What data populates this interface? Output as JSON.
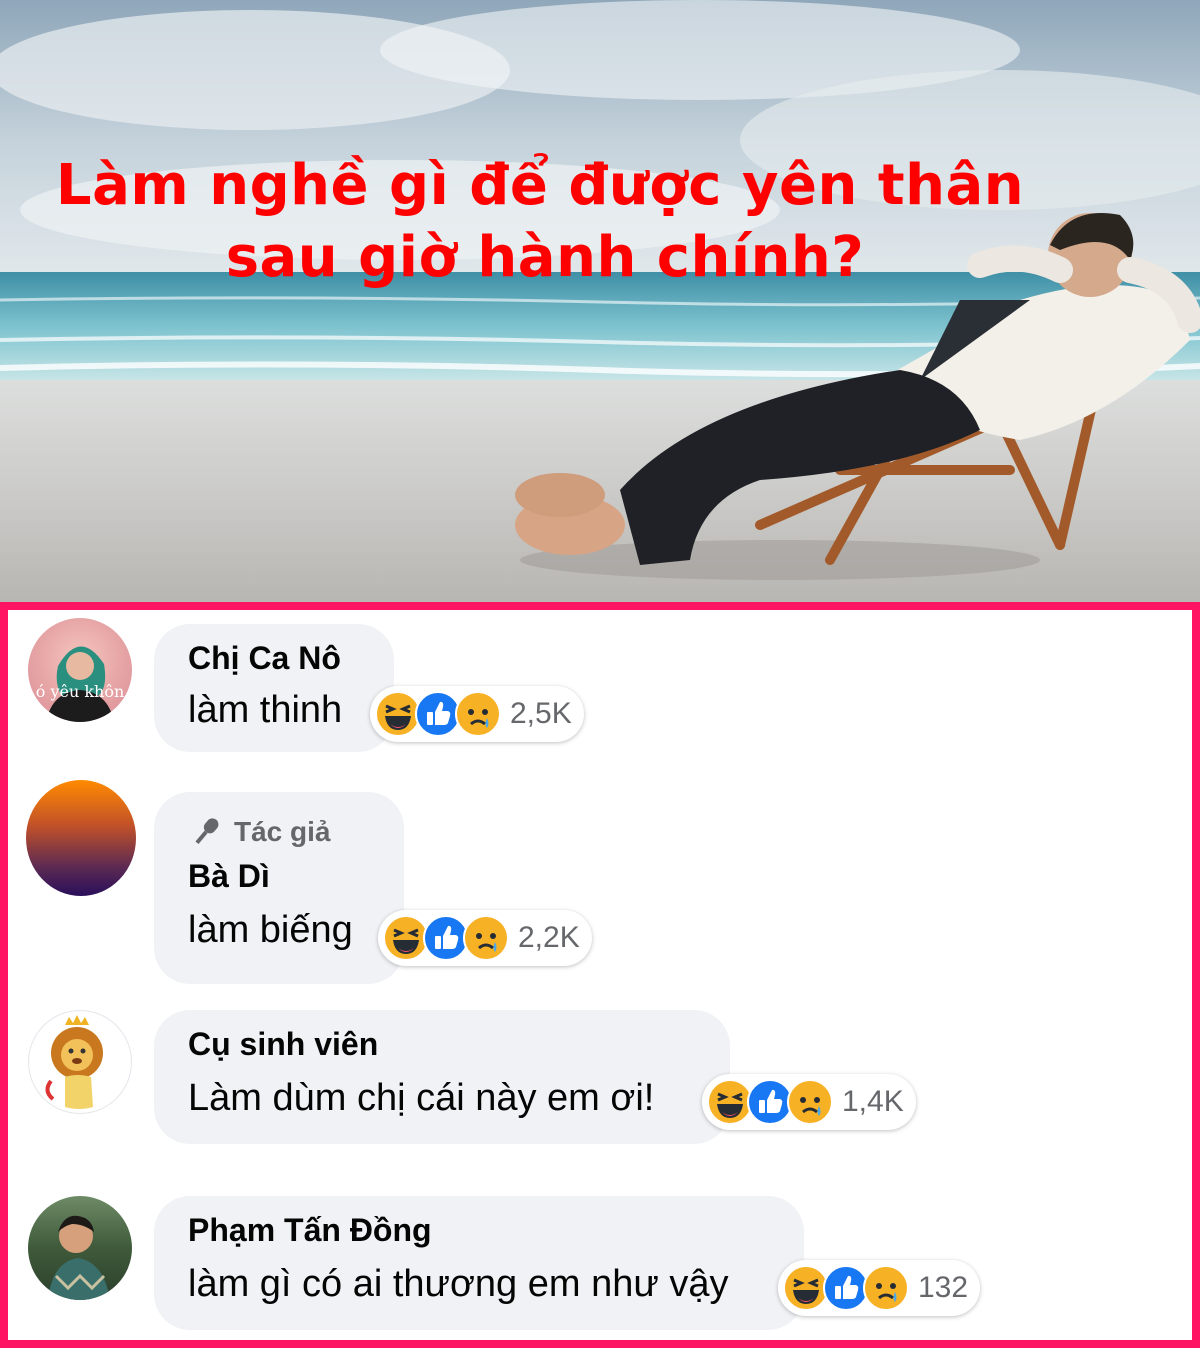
{
  "headline": {
    "line1": "Làm nghề gì để được yên thân",
    "line2": "sau giờ hành chính?"
  },
  "colors": {
    "headline": "#ff0000",
    "frame": "#ff1463",
    "bubble": "#f0f2f5",
    "count": "#65676b"
  },
  "comments": [
    {
      "author": "Chị Ca Nô",
      "text": "làm thinh",
      "reaction_count": "2,5K",
      "reactions": [
        "haha-icon",
        "like-icon",
        "sad-icon"
      ],
      "avatar_text": "ó yêu khôn"
    },
    {
      "badge": "Tác giả",
      "badge_icon": "microphone-icon",
      "author": "Bà Dì",
      "text": "làm biếng",
      "reaction_count": "2,2K",
      "reactions": [
        "haha-icon",
        "like-icon",
        "sad-icon"
      ]
    },
    {
      "author": "Cụ sinh viên",
      "text": "Làm dùm chị cái này em ơi!",
      "reaction_count": "1,4K",
      "reactions": [
        "haha-icon",
        "like-icon",
        "sad-icon"
      ]
    },
    {
      "author": "Phạm Tấn Đồng",
      "text": "làm gì có ai thương em như vậy",
      "reaction_count": "132",
      "reactions": [
        "haha-icon",
        "like-icon",
        "sad-icon"
      ]
    }
  ]
}
